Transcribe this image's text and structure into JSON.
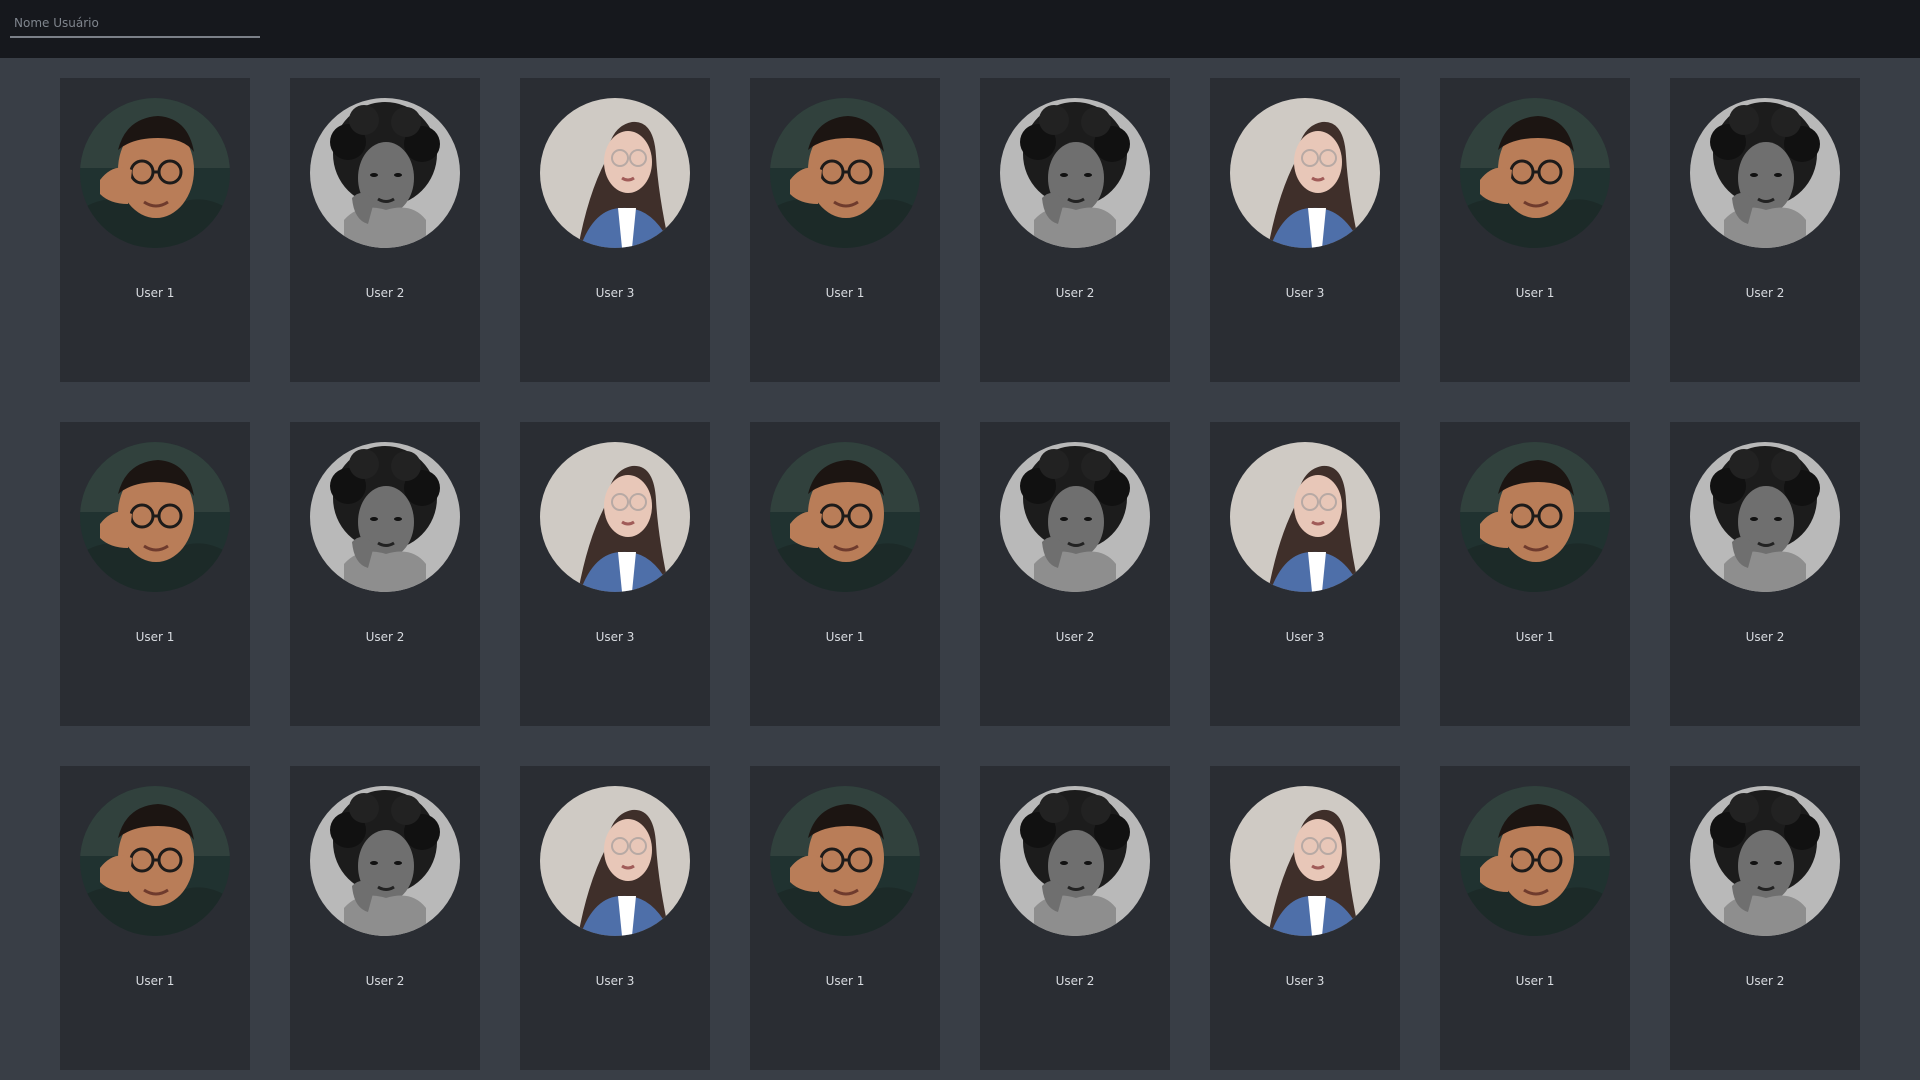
{
  "search": {
    "placeholder": "Nome Usuário",
    "value": ""
  },
  "cards": [
    {
      "name": "User 1",
      "avatar": "male-glasses-avatar"
    },
    {
      "name": "User 2",
      "avatar": "curly-hair-avatar"
    },
    {
      "name": "User 3",
      "avatar": "long-hair-denim-avatar"
    },
    {
      "name": "User 1",
      "avatar": "male-glasses-avatar"
    },
    {
      "name": "User 2",
      "avatar": "curly-hair-avatar"
    },
    {
      "name": "User 3",
      "avatar": "long-hair-denim-avatar"
    },
    {
      "name": "User 1",
      "avatar": "male-glasses-avatar"
    },
    {
      "name": "User 2",
      "avatar": "curly-hair-avatar"
    },
    {
      "name": "User 1",
      "avatar": "male-glasses-avatar"
    },
    {
      "name": "User 2",
      "avatar": "curly-hair-avatar"
    },
    {
      "name": "User 3",
      "avatar": "long-hair-denim-avatar"
    },
    {
      "name": "User 1",
      "avatar": "male-glasses-avatar"
    },
    {
      "name": "User 2",
      "avatar": "curly-hair-avatar"
    },
    {
      "name": "User 3",
      "avatar": "long-hair-denim-avatar"
    },
    {
      "name": "User 1",
      "avatar": "male-glasses-avatar"
    },
    {
      "name": "User 2",
      "avatar": "curly-hair-avatar"
    },
    {
      "name": "User 1",
      "avatar": "male-glasses-avatar"
    },
    {
      "name": "User 2",
      "avatar": "curly-hair-avatar"
    },
    {
      "name": "User 3",
      "avatar": "long-hair-denim-avatar"
    },
    {
      "name": "User 1",
      "avatar": "male-glasses-avatar"
    },
    {
      "name": "User 2",
      "avatar": "curly-hair-avatar"
    },
    {
      "name": "User 3",
      "avatar": "long-hair-denim-avatar"
    },
    {
      "name": "User 1",
      "avatar": "male-glasses-avatar"
    },
    {
      "name": "User 2",
      "avatar": "curly-hair-avatar"
    }
  ],
  "colors": {
    "topbar": "#16181d",
    "page_bg": "#393e46",
    "card_bg": "#2a2d33",
    "text": "#d8dbe0"
  }
}
